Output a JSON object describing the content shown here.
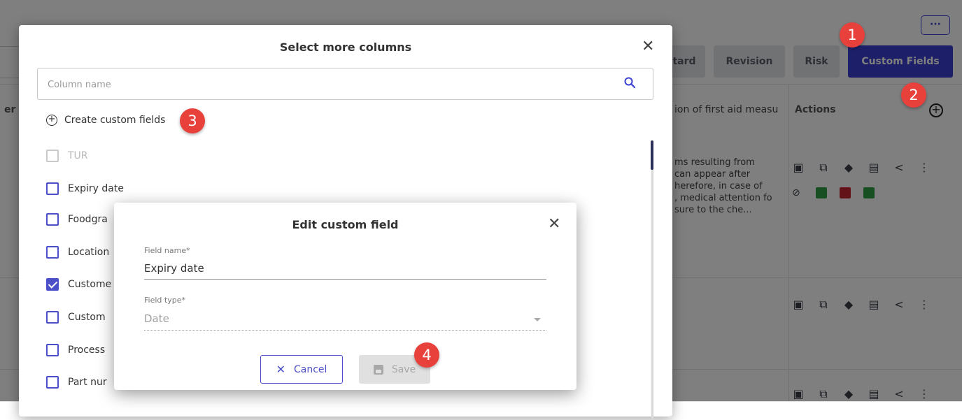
{
  "background": {
    "more_label": "···",
    "tabs": [
      {
        "label": "tard"
      },
      {
        "label": "Revision"
      },
      {
        "label": "Risk"
      },
      {
        "label": "Custom Fields"
      }
    ],
    "left_header_fragment": "er",
    "column_header_first_aid": "ion of first aid measu",
    "column_header_actions": "Actions",
    "row1_text": "ms resulting from\n can appear after\nherefore, in case of\n, medical attention fo\nsure to the che...",
    "accent_color": "#3b41d1"
  },
  "columns_dialog": {
    "title": "Select more columns",
    "search_placeholder": "Column name",
    "create_label": "Create custom fields",
    "items": [
      {
        "label": "TUR",
        "checked": false,
        "disabled": true
      },
      {
        "label": "Expiry date",
        "checked": false,
        "disabled": false
      },
      {
        "label": "Foodgra",
        "checked": false,
        "disabled": false
      },
      {
        "label": "Location",
        "checked": false,
        "disabled": false
      },
      {
        "label": "Custome",
        "checked": true,
        "disabled": false
      },
      {
        "label": "Custom",
        "checked": false,
        "disabled": false
      },
      {
        "label": "Process",
        "checked": false,
        "disabled": false
      },
      {
        "label": "Part nur",
        "checked": false,
        "disabled": false
      }
    ]
  },
  "edit_dialog": {
    "title": "Edit custom field",
    "field_name_label": "Field name*",
    "field_name_value": "Expiry date",
    "field_type_label": "Field type*",
    "field_type_value": "Date",
    "cancel_label": "Cancel",
    "save_label": "Save"
  },
  "badges": [
    "1",
    "2",
    "3",
    "4"
  ]
}
